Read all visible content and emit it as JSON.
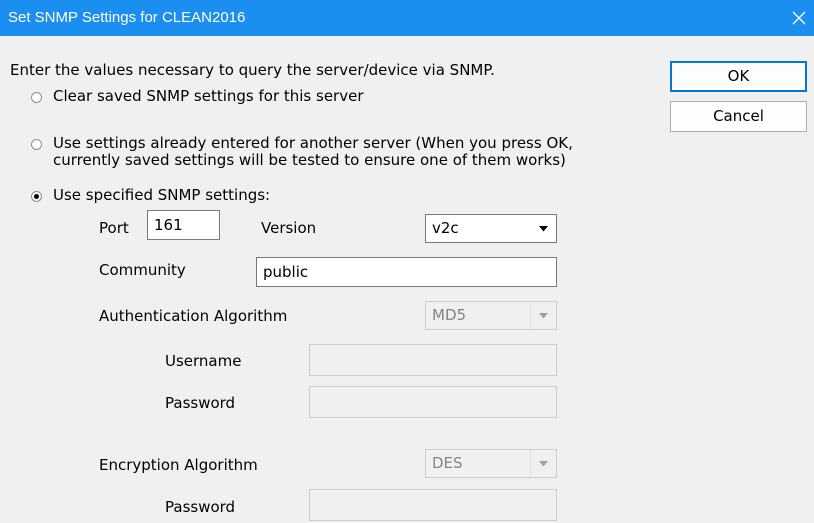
{
  "window": {
    "title": "Set SNMP Settings for CLEAN2016"
  },
  "intro": "Enter the values necessary to query the server/device via SNMP.",
  "buttons": {
    "ok": "OK",
    "cancel": "Cancel"
  },
  "options": [
    {
      "label": "Clear saved SNMP settings for this server",
      "selected": false
    },
    {
      "label_line1": "Use settings already entered for another server (When you press OK,",
      "label_line2": "currently saved settings will be tested to ensure one of them works)",
      "selected": false
    },
    {
      "label": "Use specified SNMP settings:",
      "selected": true
    }
  ],
  "form": {
    "port_label": "Port",
    "port_value": "161",
    "version_label": "Version",
    "version_value": "v2c",
    "community_label": "Community",
    "community_value": "public",
    "auth_label": "Authentication Algorithm",
    "auth_value": "MD5",
    "username_label": "Username",
    "username_value": "",
    "password_label": "Password",
    "password_value": "",
    "enc_label": "Encryption Algorithm",
    "enc_value": "DES",
    "enc_password_label": "Password",
    "enc_password_value": ""
  },
  "icons": {
    "close": "close-icon",
    "dropdown": "chevron-down-icon"
  }
}
